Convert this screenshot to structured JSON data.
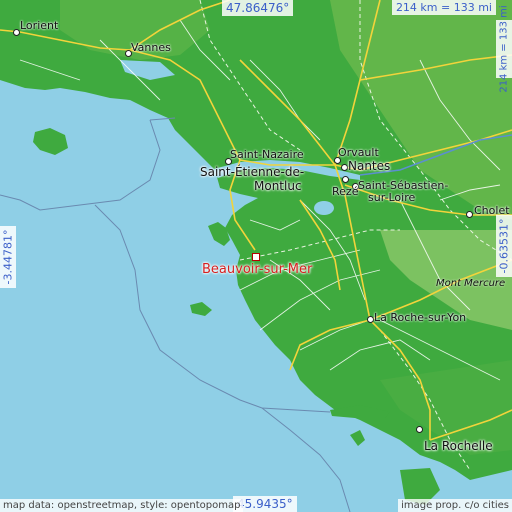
{
  "coords": {
    "top_lat": "47.86476°",
    "bottom_lat": "45.9435°",
    "left_lon": "-3.44781°",
    "right_lon": "-0.63531°"
  },
  "scale": {
    "horizontal": "214 km = 133 mi",
    "vertical": "214 km = 133 mi"
  },
  "highlight": {
    "name": "Beauvoir-sur-Mer",
    "color": "#d61f1f"
  },
  "places": {
    "lorient": "Lorient",
    "vannes": "Vannes",
    "saint_nazaire": "Saint-Nazaire",
    "orvault": "Orvault",
    "nantes": "Nantes",
    "saint_etienne": "Saint-Étienne-de-",
    "montluc": "Montluc",
    "reze": "Rezé",
    "saint_sebastien": "Saint-Sébastien-",
    "sur_loire": "sur-Loire",
    "cholet": "Cholet",
    "mont_mercure": "Mont Mercure",
    "la_roche": "La Roche-sur-Yon",
    "la_rochelle": "La Rochelle"
  },
  "attribution": {
    "left": "map data: openstreetmap, style: opentopomap",
    "right": "image prop. c/o cities"
  },
  "colors": {
    "sea": "#8fcfe6",
    "lowland": "#3faa3f",
    "upland": "#7dc25a",
    "road_primary": "#f2d43b",
    "road_minor": "#ffffff"
  }
}
